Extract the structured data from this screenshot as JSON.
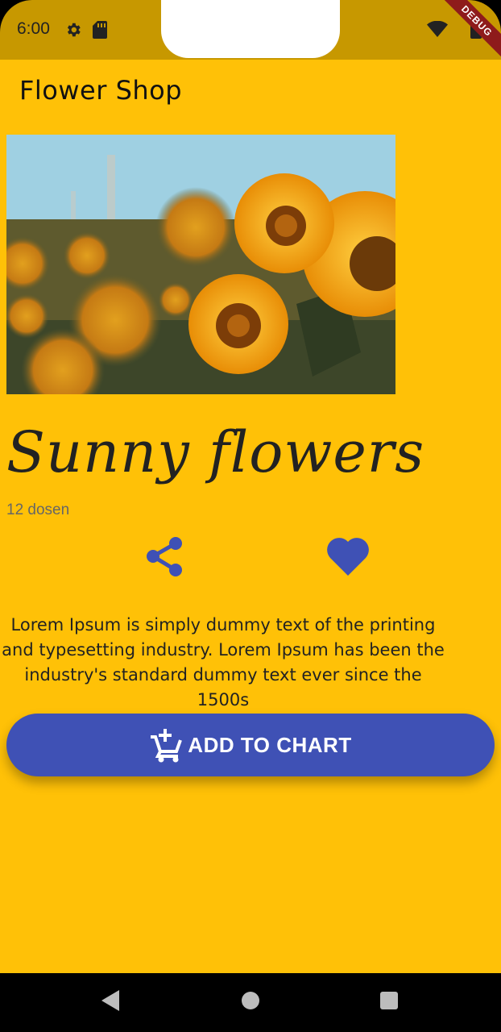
{
  "status_bar": {
    "time": "6:00",
    "debug_label": "DEBUG",
    "icons": [
      "gear-icon",
      "sd-card-icon",
      "wifi-icon",
      "battery-icon"
    ]
  },
  "app_bar": {
    "title": "Flower Shop"
  },
  "product": {
    "image_alt": "sunflower-field-photo",
    "title": "Sunny flowers",
    "subtitle": "12 dosen",
    "description": "Lorem Ipsum is simply dummy text of the printing and typesetting industry. Lorem Ipsum has been the industry's standard dummy text ever since the 1500s"
  },
  "actions": {
    "share_icon": "share-icon",
    "favorite_icon": "heart-icon",
    "add_button_label": "ADD TO CHART",
    "add_button_icon": "add-shopping-cart-icon"
  },
  "colors": {
    "background": "#FFC107",
    "status_bar": "#C79800",
    "accent": "#3F51B5",
    "debug_banner": "#8E1B1B"
  },
  "nav_bar": {
    "icons": [
      "back-icon",
      "home-icon",
      "recents-icon"
    ]
  }
}
